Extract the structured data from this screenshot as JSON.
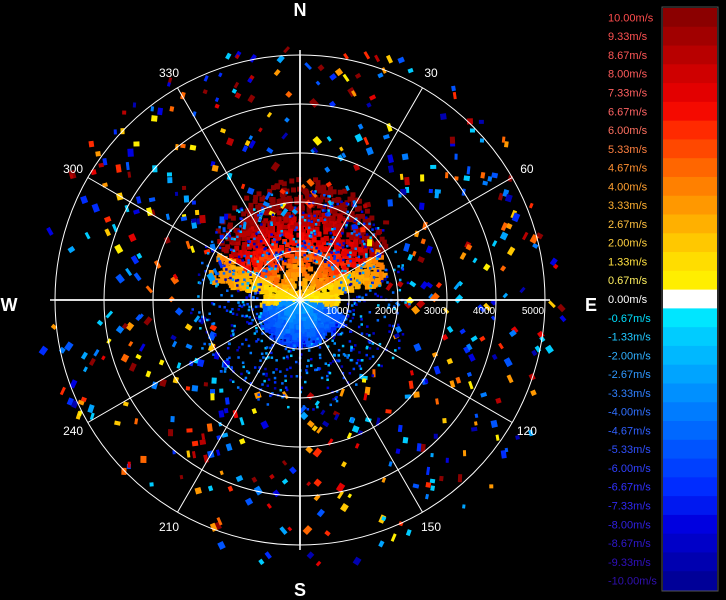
{
  "chart_data": {
    "type": "polar_radar_velocity",
    "cardinals": [
      "N",
      "E",
      "S",
      "W"
    ],
    "degree_labels": [
      {
        "text": "30",
        "angle": 30
      },
      {
        "text": "60",
        "angle": 60
      },
      {
        "text": "120",
        "angle": 120
      },
      {
        "text": "150",
        "angle": 150
      },
      {
        "text": "210",
        "angle": 210
      },
      {
        "text": "240",
        "angle": 240
      },
      {
        "text": "300",
        "angle": 300
      },
      {
        "text": "330",
        "angle": 330
      }
    ],
    "range_rings": [
      1000,
      2000,
      3000,
      4000,
      5000
    ],
    "range_labels": [
      "1000",
      "2000",
      "3000",
      "4000",
      "5000"
    ],
    "range_max": 5000,
    "legend": {
      "unit": "m/s",
      "labels": [
        "10.00m/s",
        "9.33m/s",
        "8.67m/s",
        "8.00m/s",
        "7.33m/s",
        "6.67m/s",
        "6.00m/s",
        "5.33m/s",
        "4.67m/s",
        "4.00m/s",
        "3.33m/s",
        "2.67m/s",
        "2.00m/s",
        "1.33m/s",
        "0.67m/s",
        "0.00m/s",
        "-0.67m/s",
        "-1.33m/s",
        "-2.00m/s",
        "-2.67m/s",
        "-3.33m/s",
        "-4.00m/s",
        "-4.67m/s",
        "-5.33m/s",
        "-6.00m/s",
        "-6.67m/s",
        "-7.33m/s",
        "-8.00m/s",
        "-8.67m/s",
        "-9.33m/s",
        "-10.00m/s"
      ],
      "colors": [
        "#8b0000",
        "#a10000",
        "#b80000",
        "#cf0000",
        "#e30000",
        "#f50a00",
        "#ff2a00",
        "#ff4800",
        "#ff6600",
        "#ff8000",
        "#ff9800",
        "#ffb000",
        "#ffc800",
        "#ffdd00",
        "#ffee00",
        "#ffffff",
        "#00e6ff",
        "#00ccff",
        "#00b8ff",
        "#00a4ff",
        "#0090ff",
        "#007cff",
        "#0068ff",
        "#0054ff",
        "#0040ff",
        "#002cff",
        "#0018f0",
        "#0000e0",
        "#0000c8",
        "#0000b0",
        "#000098"
      ],
      "text_colors": [
        "#ff4d4d",
        "#ff5252",
        "#ff5757",
        "#ff5c5c",
        "#ff6060",
        "#ff6464",
        "#ff7060",
        "#ff8040",
        "#ff9030",
        "#ffa030",
        "#ffb030",
        "#ffc040",
        "#ffd040",
        "#ffe040",
        "#fff060",
        "#ffffff",
        "#00e0ff",
        "#20c8ff",
        "#30b0ff",
        "#3098ff",
        "#3080ff",
        "#3070ff",
        "#3060ff",
        "#3050ff",
        "#3040ff",
        "#3030ff",
        "#3028f0",
        "#3020e0",
        "#3018d0",
        "#3010c0",
        "#3010b0"
      ]
    }
  }
}
